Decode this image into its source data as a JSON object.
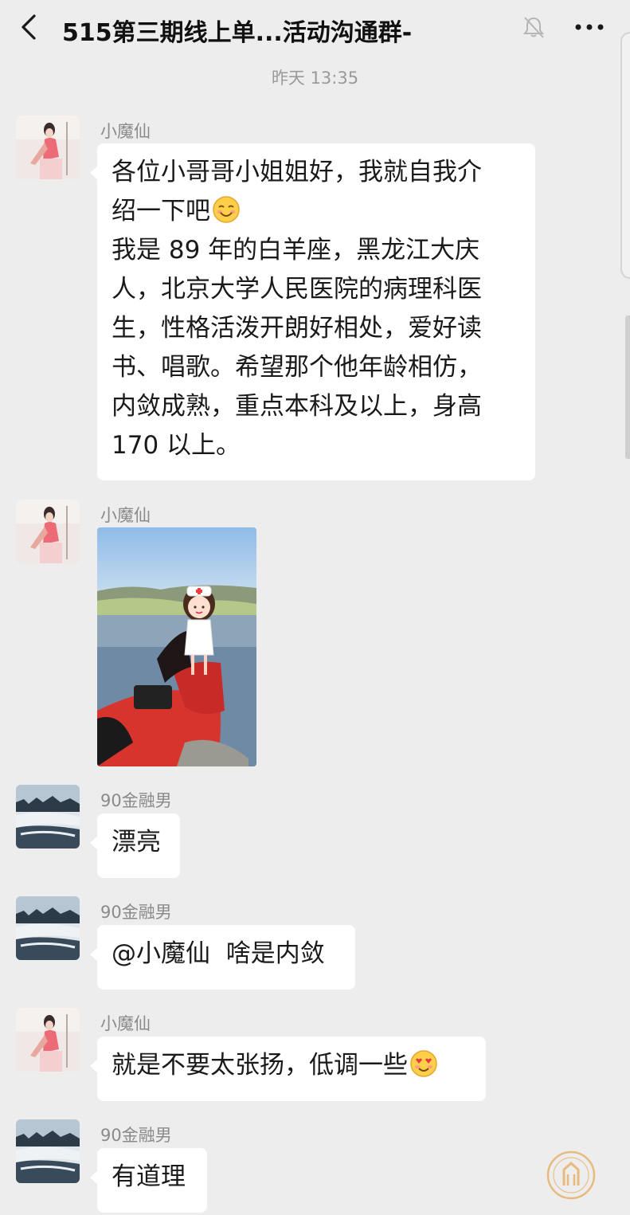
{
  "header": {
    "title": "515第三期线上单...活动沟通群-",
    "back_icon": "chevron-left-icon",
    "mute_icon": "bell-muted-icon",
    "more_icon": "more-dots-icon"
  },
  "timestamp": "昨天 13:35",
  "messages": [
    {
      "sender": "小魔仙",
      "lines": [
        "各位小哥哥小姐姐好，我就自我介",
        "绍一下吧",
        "我是 89 年的白羊座，黑龙江大庆",
        "人，北京大学人民医院的病理科医",
        "生，性格活泼开朗好相处，爱好读",
        "书、唱歌。希望那个他年龄相仿，",
        "内敛成熟，重点本科及以上，身高",
        "170 以上。"
      ],
      "emoji": "smiling-face-emoji"
    },
    {
      "sender": "小魔仙",
      "image": "photo-woman-red-coat-lake-nurse-sticker"
    },
    {
      "sender": "90金融男",
      "text": "漂亮"
    },
    {
      "sender": "90金融男",
      "text": "@小魔仙  啥是内敛"
    },
    {
      "sender": "小魔仙",
      "text": "就是不要太张扬，低调一些",
      "emoji": "heart-eyes-emoji"
    },
    {
      "sender": "90金融男",
      "text": "有道理"
    }
  ],
  "colors": {
    "background": "#ededed",
    "bubble": "#ffffff",
    "sender_text": "#8a8a8a",
    "timestamp_text": "#9a9a9a"
  }
}
